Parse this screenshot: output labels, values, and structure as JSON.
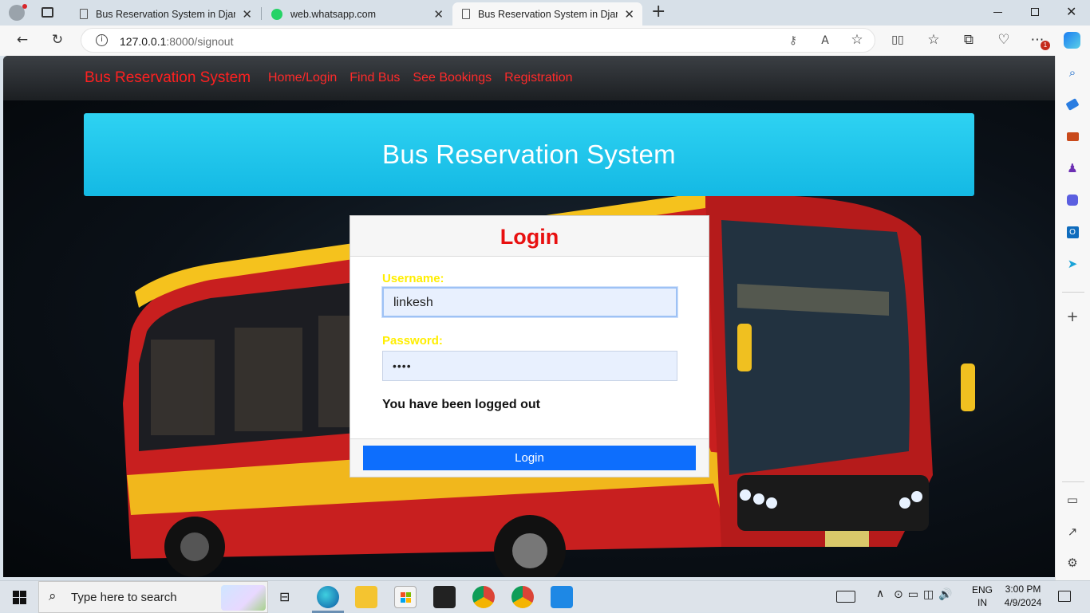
{
  "browser": {
    "tabs": [
      {
        "title": "Bus Reservation System in Djang",
        "favicon": "page-icon",
        "active": false
      },
      {
        "title": "web.whatsapp.com",
        "favicon": "whatsapp-icon",
        "active": false
      },
      {
        "title": "Bus Reservation System in Djang",
        "favicon": "page-icon",
        "active": true
      }
    ],
    "new_tab": "+",
    "url_host": "127.0.0.1",
    "url_rest": ":8000/signout",
    "notification_badge": "1"
  },
  "page": {
    "brand": "Bus Reservation System",
    "nav": [
      "Home/Login",
      "Find Bus",
      "See Bookings",
      "Registration"
    ],
    "banner_title": "Bus Reservation System",
    "login": {
      "title": "Login",
      "username_label": "Username:",
      "username_value": "linkesh",
      "password_label": "Password:",
      "password_value": "••••",
      "message": "You have been logged out",
      "button": "Login"
    },
    "colors": {
      "accent_red": "#ff2020",
      "banner_cyan": "#1bc3ea",
      "button_blue": "#0d6efd",
      "label_yellow": "#ffee00"
    }
  },
  "taskbar": {
    "search_placeholder": "Type here to search",
    "language": "ENG",
    "region": "IN",
    "time": "3:00 PM",
    "date": "4/9/2024"
  }
}
